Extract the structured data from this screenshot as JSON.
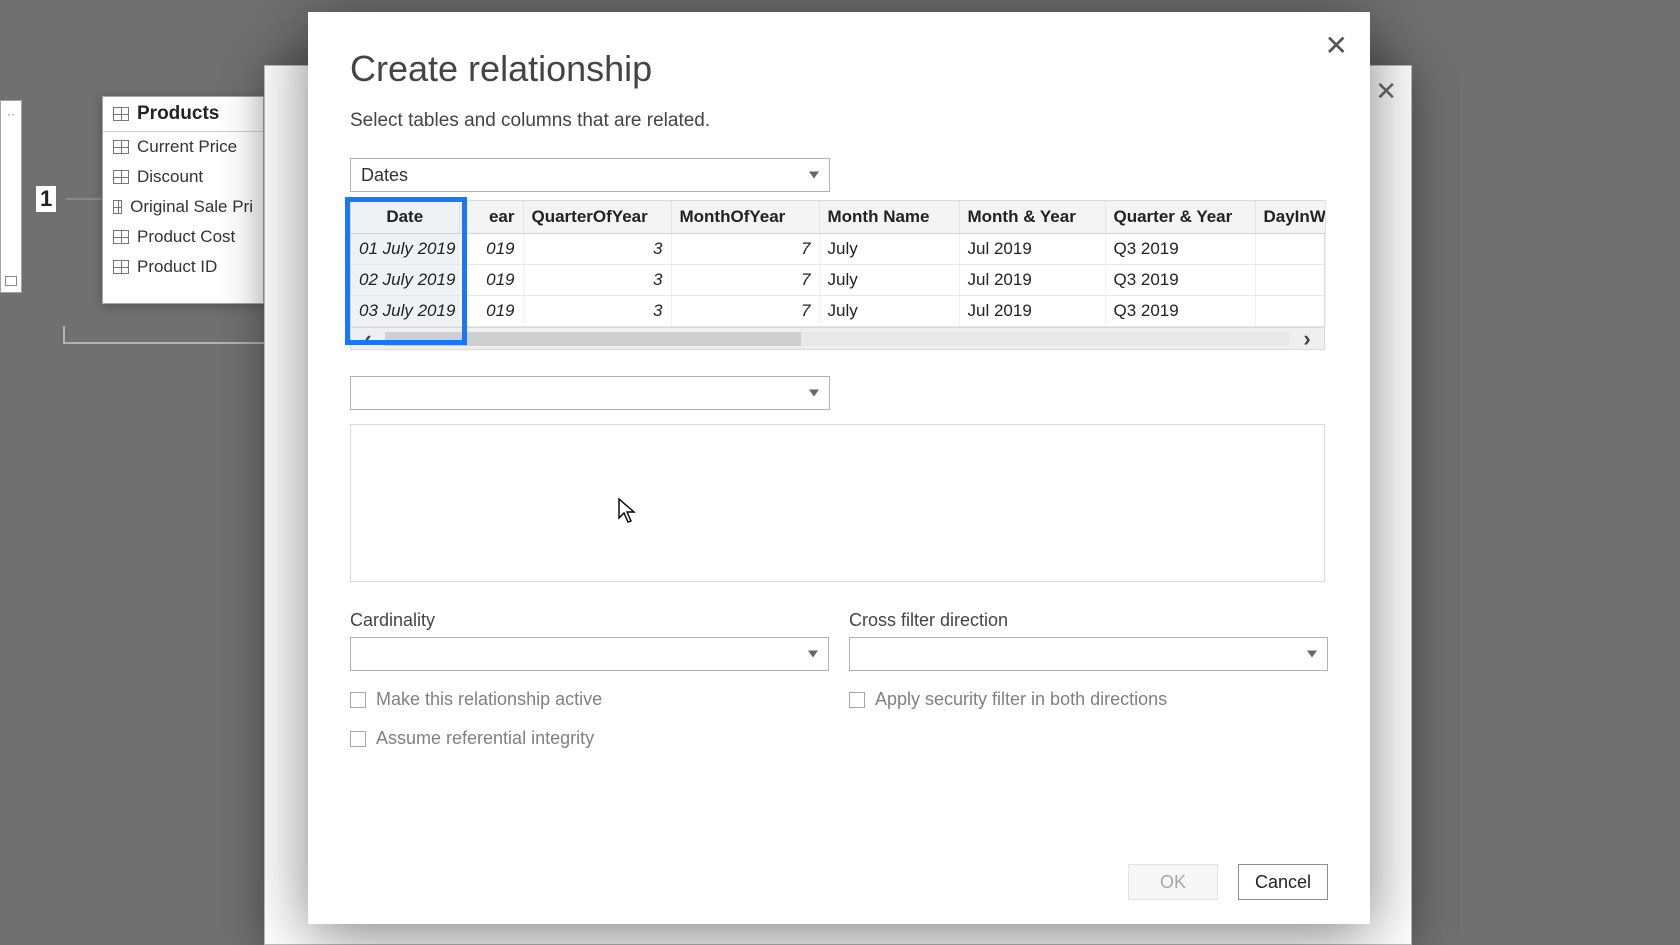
{
  "canvas": {
    "marker_number": "1",
    "products": {
      "title": "Products",
      "fields": [
        "Current Price",
        "Discount",
        "Original Sale Pri",
        "Product Cost",
        "Product ID"
      ]
    }
  },
  "dialog": {
    "title": "Create relationship",
    "subtitle": "Select tables and columns that are related.",
    "table1_select": "Dates",
    "table2_select": "",
    "columns": [
      "Date",
      "Year",
      "QuarterOfYear",
      "MonthOfYear",
      "Month Name",
      "Month & Year",
      "Quarter & Year",
      "DayInW"
    ],
    "col_year_partial": "ear",
    "rows": [
      {
        "date": "01 July 2019",
        "year": "019",
        "qoy": "3",
        "moy": "7",
        "mname": "July",
        "mny": "Jul 2019",
        "qny": "Q3 2019"
      },
      {
        "date": "02 July 2019",
        "year": "019",
        "qoy": "3",
        "moy": "7",
        "mname": "July",
        "mny": "Jul 2019",
        "qny": "Q3 2019"
      },
      {
        "date": "03 July 2019",
        "year": "019",
        "qoy": "3",
        "moy": "7",
        "mname": "July",
        "mny": "Jul 2019",
        "qny": "Q3 2019"
      }
    ],
    "cardinality_label": "Cardinality",
    "cardinality_value": "",
    "crossfilter_label": "Cross filter direction",
    "crossfilter_value": "",
    "chk_active": "Make this relationship active",
    "chk_security": "Apply security filter in both directions",
    "chk_referential": "Assume referential integrity",
    "ok": "OK",
    "cancel": "Cancel"
  }
}
